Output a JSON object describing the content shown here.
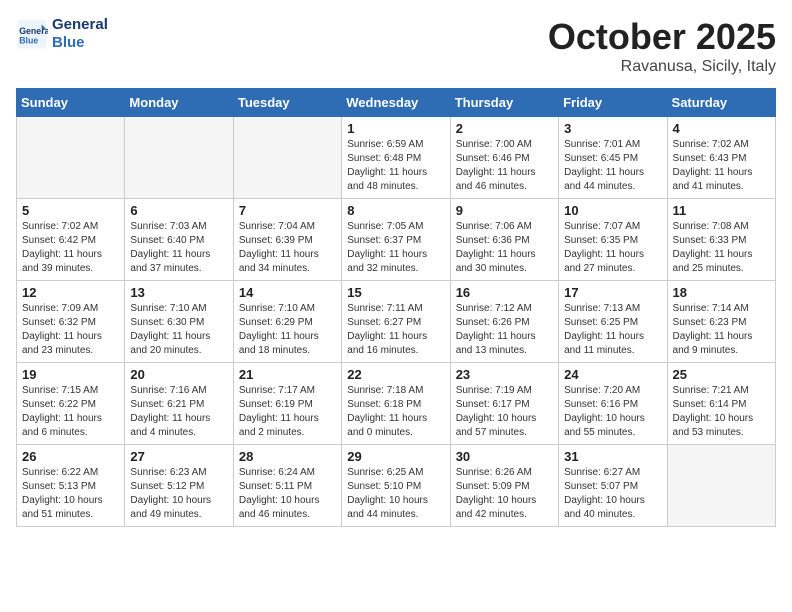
{
  "header": {
    "logo_line1": "General",
    "logo_line2": "Blue",
    "month": "October 2025",
    "location": "Ravanusa, Sicily, Italy"
  },
  "weekdays": [
    "Sunday",
    "Monday",
    "Tuesday",
    "Wednesday",
    "Thursday",
    "Friday",
    "Saturday"
  ],
  "weeks": [
    [
      {
        "day": "",
        "info": ""
      },
      {
        "day": "",
        "info": ""
      },
      {
        "day": "",
        "info": ""
      },
      {
        "day": "1",
        "info": "Sunrise: 6:59 AM\nSunset: 6:48 PM\nDaylight: 11 hours\nand 48 minutes."
      },
      {
        "day": "2",
        "info": "Sunrise: 7:00 AM\nSunset: 6:46 PM\nDaylight: 11 hours\nand 46 minutes."
      },
      {
        "day": "3",
        "info": "Sunrise: 7:01 AM\nSunset: 6:45 PM\nDaylight: 11 hours\nand 44 minutes."
      },
      {
        "day": "4",
        "info": "Sunrise: 7:02 AM\nSunset: 6:43 PM\nDaylight: 11 hours\nand 41 minutes."
      }
    ],
    [
      {
        "day": "5",
        "info": "Sunrise: 7:02 AM\nSunset: 6:42 PM\nDaylight: 11 hours\nand 39 minutes."
      },
      {
        "day": "6",
        "info": "Sunrise: 7:03 AM\nSunset: 6:40 PM\nDaylight: 11 hours\nand 37 minutes."
      },
      {
        "day": "7",
        "info": "Sunrise: 7:04 AM\nSunset: 6:39 PM\nDaylight: 11 hours\nand 34 minutes."
      },
      {
        "day": "8",
        "info": "Sunrise: 7:05 AM\nSunset: 6:37 PM\nDaylight: 11 hours\nand 32 minutes."
      },
      {
        "day": "9",
        "info": "Sunrise: 7:06 AM\nSunset: 6:36 PM\nDaylight: 11 hours\nand 30 minutes."
      },
      {
        "day": "10",
        "info": "Sunrise: 7:07 AM\nSunset: 6:35 PM\nDaylight: 11 hours\nand 27 minutes."
      },
      {
        "day": "11",
        "info": "Sunrise: 7:08 AM\nSunset: 6:33 PM\nDaylight: 11 hours\nand 25 minutes."
      }
    ],
    [
      {
        "day": "12",
        "info": "Sunrise: 7:09 AM\nSunset: 6:32 PM\nDaylight: 11 hours\nand 23 minutes."
      },
      {
        "day": "13",
        "info": "Sunrise: 7:10 AM\nSunset: 6:30 PM\nDaylight: 11 hours\nand 20 minutes."
      },
      {
        "day": "14",
        "info": "Sunrise: 7:10 AM\nSunset: 6:29 PM\nDaylight: 11 hours\nand 18 minutes."
      },
      {
        "day": "15",
        "info": "Sunrise: 7:11 AM\nSunset: 6:27 PM\nDaylight: 11 hours\nand 16 minutes."
      },
      {
        "day": "16",
        "info": "Sunrise: 7:12 AM\nSunset: 6:26 PM\nDaylight: 11 hours\nand 13 minutes."
      },
      {
        "day": "17",
        "info": "Sunrise: 7:13 AM\nSunset: 6:25 PM\nDaylight: 11 hours\nand 11 minutes."
      },
      {
        "day": "18",
        "info": "Sunrise: 7:14 AM\nSunset: 6:23 PM\nDaylight: 11 hours\nand 9 minutes."
      }
    ],
    [
      {
        "day": "19",
        "info": "Sunrise: 7:15 AM\nSunset: 6:22 PM\nDaylight: 11 hours\nand 6 minutes."
      },
      {
        "day": "20",
        "info": "Sunrise: 7:16 AM\nSunset: 6:21 PM\nDaylight: 11 hours\nand 4 minutes."
      },
      {
        "day": "21",
        "info": "Sunrise: 7:17 AM\nSunset: 6:19 PM\nDaylight: 11 hours\nand 2 minutes."
      },
      {
        "day": "22",
        "info": "Sunrise: 7:18 AM\nSunset: 6:18 PM\nDaylight: 11 hours\nand 0 minutes."
      },
      {
        "day": "23",
        "info": "Sunrise: 7:19 AM\nSunset: 6:17 PM\nDaylight: 10 hours\nand 57 minutes."
      },
      {
        "day": "24",
        "info": "Sunrise: 7:20 AM\nSunset: 6:16 PM\nDaylight: 10 hours\nand 55 minutes."
      },
      {
        "day": "25",
        "info": "Sunrise: 7:21 AM\nSunset: 6:14 PM\nDaylight: 10 hours\nand 53 minutes."
      }
    ],
    [
      {
        "day": "26",
        "info": "Sunrise: 6:22 AM\nSunset: 5:13 PM\nDaylight: 10 hours\nand 51 minutes."
      },
      {
        "day": "27",
        "info": "Sunrise: 6:23 AM\nSunset: 5:12 PM\nDaylight: 10 hours\nand 49 minutes."
      },
      {
        "day": "28",
        "info": "Sunrise: 6:24 AM\nSunset: 5:11 PM\nDaylight: 10 hours\nand 46 minutes."
      },
      {
        "day": "29",
        "info": "Sunrise: 6:25 AM\nSunset: 5:10 PM\nDaylight: 10 hours\nand 44 minutes."
      },
      {
        "day": "30",
        "info": "Sunrise: 6:26 AM\nSunset: 5:09 PM\nDaylight: 10 hours\nand 42 minutes."
      },
      {
        "day": "31",
        "info": "Sunrise: 6:27 AM\nSunset: 5:07 PM\nDaylight: 10 hours\nand 40 minutes."
      },
      {
        "day": "",
        "info": ""
      }
    ]
  ]
}
